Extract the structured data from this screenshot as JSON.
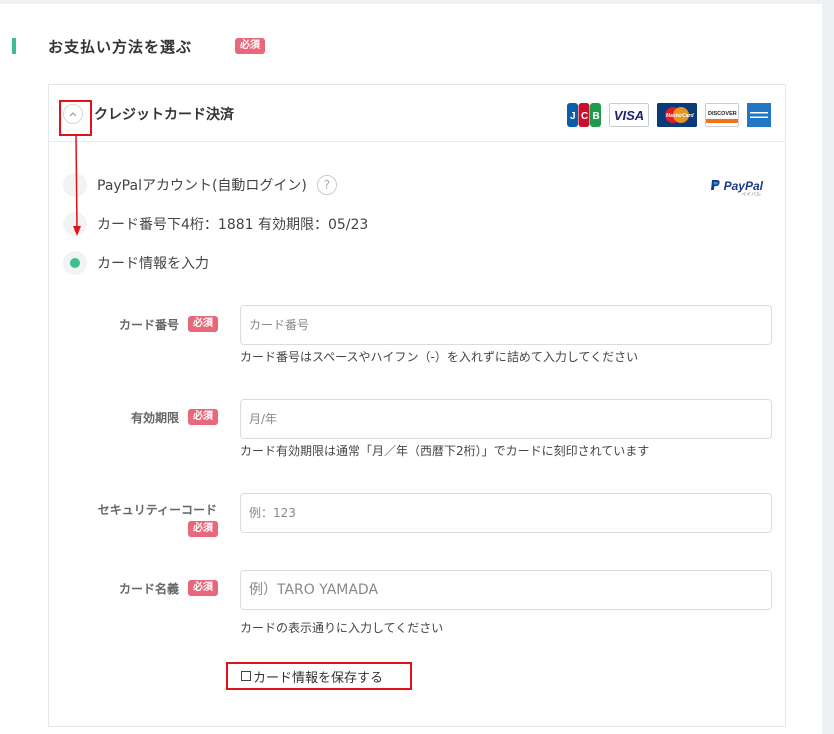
{
  "section": {
    "title": "お支払い方法を選ぶ",
    "required_badge": "必須"
  },
  "panel": {
    "title": "クレジットカード決済",
    "toggle_icon": "chevron-up-icon",
    "brands": [
      "JCB",
      "VISA",
      "MasterCard",
      "DISCOVER",
      "AMERICAN EXPRESS"
    ]
  },
  "options": [
    {
      "label": "PayPalアカウント(自動ログイン)",
      "selected": false,
      "help_icon": "?"
    },
    {
      "label": "カード番号下4桁：1881 有効期限：05/23",
      "selected": false
    },
    {
      "label": "カード情報を入力",
      "selected": true
    }
  ],
  "paypal": {
    "logo_text": "PayPal",
    "sub_text": "ペイパル"
  },
  "fields": [
    {
      "label": "カード番号",
      "badge": "必須",
      "placeholder": "カード番号",
      "help": "カード番号はスペースやハイフン（-）を入れずに詰めて入力してください"
    },
    {
      "label": "有効期限",
      "badge": "必須",
      "placeholder": "月/年",
      "help": "カード有効期限は通常「月／年（西暦下2桁）」でカードに刻印されています"
    },
    {
      "label": "セキュリティーコード",
      "badge": "必須",
      "placeholder": "例：123",
      "help": ""
    },
    {
      "label": "カード名義",
      "badge": "必須",
      "placeholder": "例）TARO YAMADA",
      "help": "カードの表示通りに入力してください"
    }
  ],
  "save_card": {
    "label": "カード情報を保存する",
    "checked": false
  },
  "colors": {
    "accent_green": "#3cc08c",
    "badge_pink": "#e8677a",
    "annotation_red": "#e1121a"
  }
}
